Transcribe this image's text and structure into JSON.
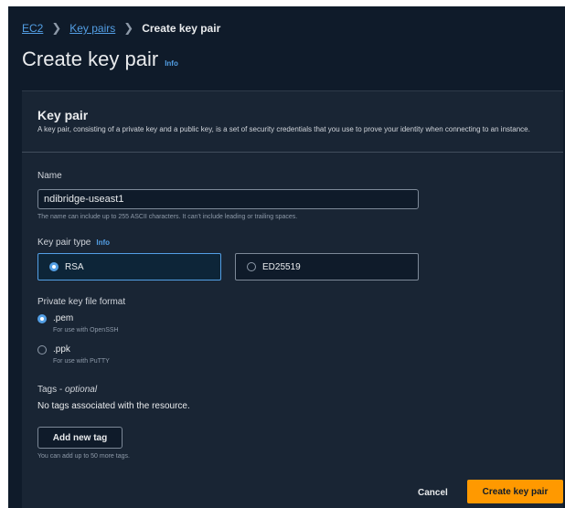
{
  "breadcrumb": {
    "items": [
      "EC2",
      "Key pairs"
    ],
    "current": "Create key pair"
  },
  "page": {
    "title": "Create key pair",
    "info": "Info"
  },
  "key_pair": {
    "title": "Key pair",
    "description": "A key pair, consisting of a private key and a public key, is a set of security credentials that you use to prove your identity when connecting to an instance."
  },
  "name_field": {
    "label": "Name",
    "value": "ndibridge-useast1",
    "hint": "The name can include up to 255 ASCII characters. It can't include leading or trailing spaces."
  },
  "key_type": {
    "label": "Key pair type",
    "info": "Info",
    "options": [
      "RSA",
      "ED25519"
    ],
    "selected": "RSA"
  },
  "file_format": {
    "label": "Private key file format",
    "options": [
      {
        "value": ".pem",
        "description": "For use with OpenSSH"
      },
      {
        "value": ".ppk",
        "description": "For use with PuTTY"
      }
    ],
    "selected": ".pem"
  },
  "tags": {
    "label": "Tags",
    "label_suffix": "optional",
    "empty_text": "No tags associated with the resource.",
    "add_button": "Add new tag",
    "hint": "You can add up to 50 more tags."
  },
  "footer": {
    "cancel": "Cancel",
    "submit": "Create key pair"
  },
  "colors": {
    "background": "#0f1b2a",
    "panel": "#192534",
    "link": "#539fe5",
    "primary_button": "#ff9900"
  }
}
